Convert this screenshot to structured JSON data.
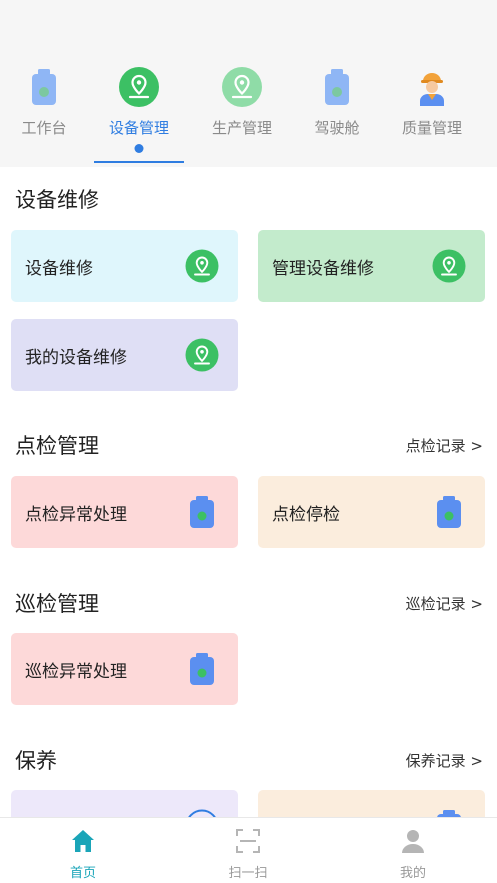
{
  "top_tabs": [
    {
      "label": "工作台",
      "icon": "bottle-icon"
    },
    {
      "label": "设备管理",
      "icon": "location-badge-icon"
    },
    {
      "label": "生产管理",
      "icon": "location-badge-icon"
    },
    {
      "label": "驾驶舱",
      "icon": "bottle-icon"
    },
    {
      "label": "质量管理",
      "icon": "worker-icon"
    }
  ],
  "active_tab": "设备管理",
  "sections": {
    "repair": {
      "title": "设备维修",
      "cards": [
        "设备维修",
        "管理设备维修",
        "我的设备维修"
      ]
    },
    "inspection": {
      "title": "点检管理",
      "link": "点检记录 >",
      "cards": [
        "点检异常处理",
        "点检停检"
      ]
    },
    "patrol": {
      "title": "巡检管理",
      "link": "巡检记录 >",
      "cards": [
        "巡检异常处理"
      ]
    },
    "maintenance": {
      "title": "保养",
      "link": "保养记录 >"
    }
  },
  "bottom_nav": [
    {
      "label": "首页",
      "icon": "home-icon"
    },
    {
      "label": "扫一扫",
      "icon": "scan-icon"
    },
    {
      "label": "我的",
      "icon": "user-icon"
    }
  ],
  "colors": {
    "accent": "#2f7de1",
    "nav_active": "#1aa5b8",
    "card_cyan": "#dff6fc",
    "card_green": "#c3ebcc",
    "card_lavender": "#dfdff5",
    "card_pink": "#fdd9d9",
    "card_beige": "#fbeddd",
    "card_purple": "#ede8fa",
    "icon_green": "#3cc064",
    "icon_blue": "#5b8ff0"
  }
}
